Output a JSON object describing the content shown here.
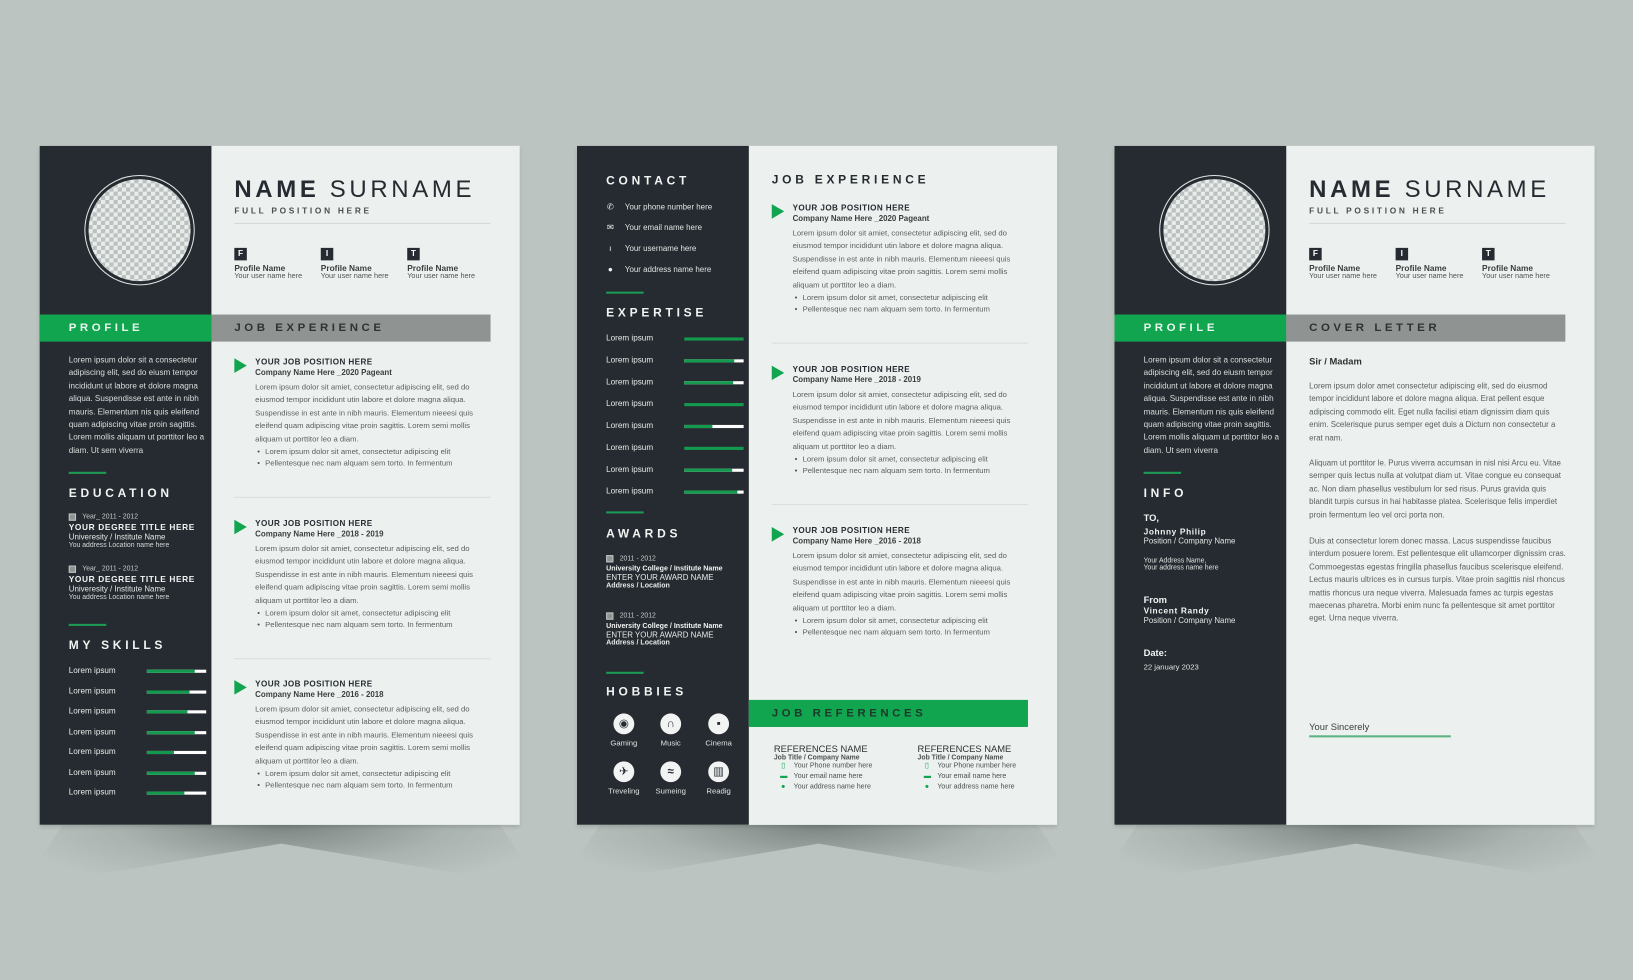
{
  "colors": {
    "dark": "#252b30",
    "green": "#12a550",
    "gray_band": "#8f9493",
    "paper": "#ecf1ef",
    "background": "#bcc4c1"
  },
  "resume1": {
    "name_first": "NAME",
    "name_last": "SURNAME",
    "position": "FULL POSITION HERE",
    "socials": [
      {
        "icon": "facebook-icon",
        "letter": "F",
        "name": "Profile Name",
        "user": "Your user name here"
      },
      {
        "icon": "instagram-icon",
        "letter": "I",
        "name": "Profile Name",
        "user": "Your user name here"
      },
      {
        "icon": "twitter-icon",
        "letter": "T",
        "name": "Profile Name",
        "user": "Your user name here"
      }
    ],
    "profile_heading": "PROFILE",
    "profile_text": "Lorem ipsum dolor sit a consectetur adipiscing elit, sed do eiusm tempor incididunt ut labore et dolore magna aliqua. Suspendisse  est ante in nibh mauris. Elementum nis quis eleifend quam adipiscing vitae proin sagittis. Lorem mollis aliquam ut porttitor leo a diam. Ut sem viverra",
    "education_heading": "EDUCATION",
    "education": [
      {
        "year": "Year_ 2011 - 2012",
        "degree": "YOUR DEGREE TITLE HERE",
        "university": "Univeresity / Institute Name",
        "location": "You address Location name here"
      },
      {
        "year": "Year_ 2011 - 2012",
        "degree": "YOUR DEGREE TITLE HERE",
        "university": "Univeresity / Institute Name",
        "location": "You address Location name here"
      }
    ],
    "skills_heading": "MY SKILLS",
    "skills": [
      {
        "label": "Lorem ipsum",
        "level": 0.8
      },
      {
        "label": "Lorem ipsum",
        "level": 0.72
      },
      {
        "label": "Lorem ipsum",
        "level": 0.68
      },
      {
        "label": "Lorem ipsum",
        "level": 0.8
      },
      {
        "label": "Lorem ipsum",
        "level": 0.45
      },
      {
        "label": "Lorem ipsum",
        "level": 0.8
      },
      {
        "label": "Lorem ipsum",
        "level": 0.63
      }
    ],
    "job_heading": "JOB EXPERIENCE",
    "jobs": [
      {
        "position": "YOUR JOB POSITION HERE",
        "company": "Company Name Here _2020 Pageant",
        "description": "Lorem ipsum dolor sit amiet, consectetur adipiscing elit, sed do eiusmod tempor incididunt utin labore et dolore magna aliqua. Suspendisse in est ante in nibh mauris. Elementum nieeesi quis eleifend quam adipiscing vitae proin sagittis. Lorem semi mollis aliquam ut porttitor leo a diam.",
        "bullets": [
          "Lorem ipsum dolor sit amet, consectetur adipiscing elit",
          "Pellentesque nec nam alquam sem torto. In fermentum"
        ]
      },
      {
        "position": "YOUR JOB POSITION HERE",
        "company": "Company Name Here _2018 - 2019",
        "description": "Lorem ipsum dolor sit amiet, consectetur adipiscing elit, sed do eiusmod tempor incididunt utin labore et dolore magna aliqua. Suspendisse in est ante in nibh mauris. Elementum nieeesi quis eleifend quam adipiscing vitae proin sagittis. Lorem semi mollis aliquam ut porttitor leo a diam.",
        "bullets": [
          "Lorem ipsum dolor sit amet, consectetur adipiscing elit",
          "Pellentesque nec nam alquam sem torto. In fermentum"
        ]
      },
      {
        "position": "YOUR JOB POSITION HERE",
        "company": "Company Name Here _2016 - 2018",
        "description": "Lorem ipsum dolor sit amiet, consectetur adipiscing elit, sed do eiusmod tempor incididunt utin labore et dolore magna aliqua. Suspendisse in est ante in nibh mauris. Elementum nieeesi quis eleifend quam adipiscing vitae proin sagittis. Lorem semi mollis aliquam ut porttitor leo a diam.",
        "bullets": [
          "Lorem ipsum dolor sit amet, consectetur adipiscing elit",
          "Pellentesque nec nam alquam sem torto. In fermentum"
        ]
      }
    ]
  },
  "resume2": {
    "contact_heading": "CONTACT",
    "contact": [
      {
        "icon": "phone-icon",
        "glyph": "✆",
        "text": "Your phone number here"
      },
      {
        "icon": "email-icon",
        "glyph": "✉",
        "text": "Your email name here"
      },
      {
        "icon": "user-icon",
        "glyph": "ı",
        "text": "Your username here"
      },
      {
        "icon": "location-pin-icon",
        "glyph": "●",
        "text": "Your address name here"
      }
    ],
    "expertise_heading": "EXPERTISE",
    "expertise": [
      {
        "label": "Lorem ipsum",
        "level": 1.0
      },
      {
        "label": "Lorem ipsum",
        "level": 0.85
      },
      {
        "label": "Lorem ipsum",
        "level": 0.82
      },
      {
        "label": "Lorem ipsum",
        "level": 1.0
      },
      {
        "label": "Lorem ipsum",
        "level": 0.48
      },
      {
        "label": "Lorem ipsum",
        "level": 1.0
      },
      {
        "label": "Lorem ipsum",
        "level": 0.8
      },
      {
        "label": "Lorem ipsum",
        "level": 0.9
      }
    ],
    "awards_heading": "AWARDS",
    "awards": [
      {
        "year": "2011 - 2012",
        "college": "University  College / Institute Name",
        "award": "ENTER YOUR AWARD NAME",
        "address": "Address / Location"
      },
      {
        "year": "2011 - 2012",
        "college": "University  College / Institute Name",
        "award": "ENTER YOUR AWARD NAME",
        "address": "Address / Location"
      }
    ],
    "hobbies_heading": "HOBBIES",
    "hobbies": [
      {
        "icon": "gamepad-icon",
        "glyph": "🎮",
        "label": "Gaming"
      },
      {
        "icon": "headphones-icon",
        "glyph": "🎧",
        "label": "Music"
      },
      {
        "icon": "camera-icon",
        "glyph": "🎥",
        "label": "Cinema"
      },
      {
        "icon": "airplane-icon",
        "glyph": "✈",
        "label": "Treveling"
      },
      {
        "icon": "swimming-icon",
        "glyph": "🏊",
        "label": "Sumeing"
      },
      {
        "icon": "book-icon",
        "glyph": "📖",
        "label": "Readig"
      }
    ],
    "job_heading": "JOB EXPERIENCE",
    "jobs": [
      {
        "position": "YOUR JOB POSITION HERE",
        "company": "Company Name Here _2020 Pageant",
        "description": "Lorem ipsum dolor sit amiet, consectetur adipiscing elit, sed do eiusmod tempor incididunt utin labore et dolore magna aliqua. Suspendisse in est ante in nibh mauris. Elementum nieeesi quis eleifend quam adipiscing vitae proin sagittis. Lorem semi mollis aliquam ut porttitor leo a diam.",
        "bullets": [
          "Lorem ipsum dolor sit amet, consectetur adipiscing elit",
          "Pellentesque nec nam alquam sem torto. In fermentum"
        ]
      },
      {
        "position": "YOUR JOB POSITION HERE",
        "company": "Company Name Here _2018 - 2019",
        "description": "Lorem ipsum dolor sit amiet, consectetur adipiscing elit, sed do eiusmod tempor incididunt utin labore et dolore magna aliqua. Suspendisse in est ante in nibh mauris. Elementum nieeesi quis eleifend quam adipiscing vitae proin sagittis. Lorem semi mollis aliquam ut porttitor leo a diam.",
        "bullets": [
          "Lorem ipsum dolor sit amet, consectetur adipiscing elit",
          "Pellentesque nec nam alquam sem torto. In fermentum"
        ]
      },
      {
        "position": "YOUR JOB POSITION HERE",
        "company": "Company Name Here _2016 - 2018",
        "description": "Lorem ipsum dolor sit amiet, consectetur adipiscing elit, sed do eiusmod tempor incididunt utin labore et dolore magna aliqua. Suspendisse in est ante in nibh mauris. Elementum nieeesi quis eleifend quam adipiscing vitae proin sagittis. Lorem semi mollis aliquam ut porttitor leo a diam.",
        "bullets": [
          "Lorem ipsum dolor sit amet, consectetur adipiscing elit",
          "Pellentesque nec nam alquam sem torto. In fermentum"
        ]
      }
    ],
    "references_heading": "JOB REFERENCES",
    "references": [
      {
        "name": "REFERENCES NAME",
        "title": "Job Title / Company Name",
        "phone": "Your Phone number here",
        "email": "Your email name here",
        "address": "Your address name here"
      },
      {
        "name": "REFERENCES NAME",
        "title": "Job Title / Company Name",
        "phone": "Your Phone number here",
        "email": "Your email name here",
        "address": "Your address name here"
      }
    ]
  },
  "cover": {
    "name_first": "NAME",
    "name_last": "SURNAME",
    "position": "FULL POSITION HERE",
    "socials": [
      {
        "icon": "facebook-icon",
        "letter": "F",
        "name": "Profile Name",
        "user": "Your user name here"
      },
      {
        "icon": "instagram-icon",
        "letter": "I",
        "name": "Profile Name",
        "user": "Your user name here"
      },
      {
        "icon": "twitter-icon",
        "letter": "T",
        "name": "Profile Name",
        "user": "Your user name here"
      }
    ],
    "profile_heading": "PROFILE",
    "profile_text": "Lorem ipsum dolor sit a consectetur adipiscing elit, sed do eiusm tempor incididunt ut labore et dolore magna aliqua. Suspendisse  est ante in nibh mauris. Elementum nis quis eleifend quam adipiscing vitae proin sagittis. Lorem mollis aliquam ut porttitor leo a diam. Ut sem viverra",
    "info_heading": "INFO",
    "to_label": "TO,",
    "to_name": "Johnny Philip",
    "to_position": "Position / Company Name",
    "address_line1": "Your Address Name,",
    "address_line2": "Your address name here",
    "from_label": "From",
    "from_name": "Vincent Randy",
    "from_position": "Position / Company Name",
    "date_label": "Date:",
    "date_value": "22  january 2023",
    "letter_heading": "COVER LETTER",
    "salutation": "Sir / Madam",
    "paragraphs": [
      "Lorem ipsum dolor amet consectetur adipiscing elit, sed do eiusmod tempor incididunt labore et dolore magna aliqua. Erat pellent esque adipiscing commodo elit. Eget nulla facilisi etiam dignissim diam quis enim. Scelerisque purus semper eget duis a Dictum non consectetur a erat nam.",
      "Aliquam ut porttitor le. Purus viverra accumsan in nisl nisi Arcu eu. Vitae semper quis lectus nulla at volutpat diam ut. Vitae congue eu consequat ac. Non diam phasellus vestibulum lor sed risus. Purus gravida quis blandit turpis cursus in hai habitasse platea. Scelerisque felis imperdiet proin fermentum leo vel orci porta non.",
      "Duis at consectetur lorem donec massa. Lacus suspendisse faucibus interdum posuere lorem. Est pellentesque elit ullamcorper dignissim cras. Commoegestas egestas fringilla phasellus faucibus scelerisque eleifend. Lectus mauris ultrices es in cursus turpis. Vitae proin sagittis nisl rhoncus mattis rhoncus ura neque viverra. Malesuada fames ac turpis egestas maecenas pharetra. Morbi enim nunc fa pellentesque sit amet porttitor eget. Urna neque viverra."
    ],
    "closing": "Your Sincerely"
  }
}
